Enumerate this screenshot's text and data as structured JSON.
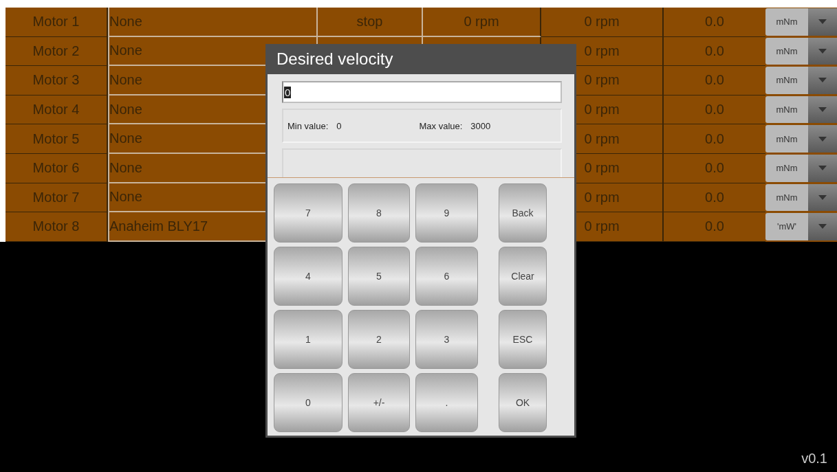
{
  "motors": [
    {
      "name": "Motor 1",
      "type": "None",
      "state": "stop",
      "command": "0 rpm",
      "speed": "0 rpm",
      "torque": "0.0",
      "unit": "mNm"
    },
    {
      "name": "Motor 2",
      "type": "None",
      "speed": "0 rpm",
      "torque": "0.0",
      "unit": "mNm"
    },
    {
      "name": "Motor 3",
      "type": "None",
      "speed": "0 rpm",
      "torque": "0.0",
      "unit": "mNm"
    },
    {
      "name": "Motor 4",
      "type": "None",
      "speed": "0 rpm",
      "torque": "0.0",
      "unit": "mNm"
    },
    {
      "name": "Motor 5",
      "type": "None",
      "speed": "0 rpm",
      "torque": "0.0",
      "unit": "mNm"
    },
    {
      "name": "Motor 6",
      "type": "None",
      "speed": "0 rpm",
      "torque": "0.0",
      "unit": "mNm"
    },
    {
      "name": "Motor 7",
      "type": "None",
      "speed": "0 rpm",
      "torque": "0.0",
      "unit": "mNm"
    },
    {
      "name": "Motor 8",
      "type": "Anaheim BLY17",
      "speed": "0 rpm",
      "torque": "0.0",
      "unit": "'mW'"
    }
  ],
  "dialog": {
    "title": "Desired velocity",
    "value": "0",
    "min_label": "Min value:",
    "min_value": "0",
    "max_label": "Max value:",
    "max_value": "3000",
    "keys": [
      [
        "7",
        "8",
        "9",
        "Back"
      ],
      [
        "4",
        "5",
        "6",
        "Clear"
      ],
      [
        "1",
        "2",
        "3",
        "ESC"
      ],
      [
        "0",
        "+/-",
        ".",
        "OK"
      ]
    ]
  },
  "version": "v0.1"
}
